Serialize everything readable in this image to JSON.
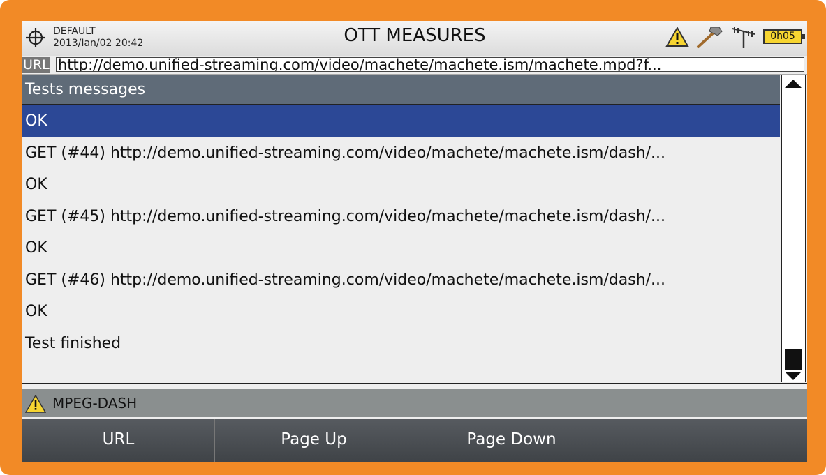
{
  "header": {
    "profile": "DEFAULT",
    "datetime": "2013/Ian/02 20:42",
    "title": "OTT MEASURES",
    "battery": "0h05",
    "icons": [
      "crosshair-icon",
      "warning-icon",
      "hammer-icon",
      "antenna-icon",
      "battery-icon"
    ]
  },
  "url": {
    "tag": "URL",
    "value": "http://demo.unified-streaming.com/video/machete/machete.ism/machete.mpd?f..."
  },
  "list": {
    "header": "Tests messages",
    "items": [
      "OK",
      "GET (#44) http://demo.unified-streaming.com/video/machete/machete.ism/dash/...",
      "OK",
      "GET (#45) http://demo.unified-streaming.com/video/machete/machete.ism/dash/...",
      "OK",
      "GET (#46) http://demo.unified-streaming.com/video/machete/machete.ism/dash/...",
      "OK",
      "Test finished"
    ],
    "selected_index": 0
  },
  "status": {
    "text": "MPEG-DASH"
  },
  "softkeys": [
    "URL",
    "Page Up",
    "Page Down",
    ""
  ],
  "colors": {
    "frame": "#f28a26",
    "selected": "#2c4896",
    "warning": "#f7d531"
  }
}
